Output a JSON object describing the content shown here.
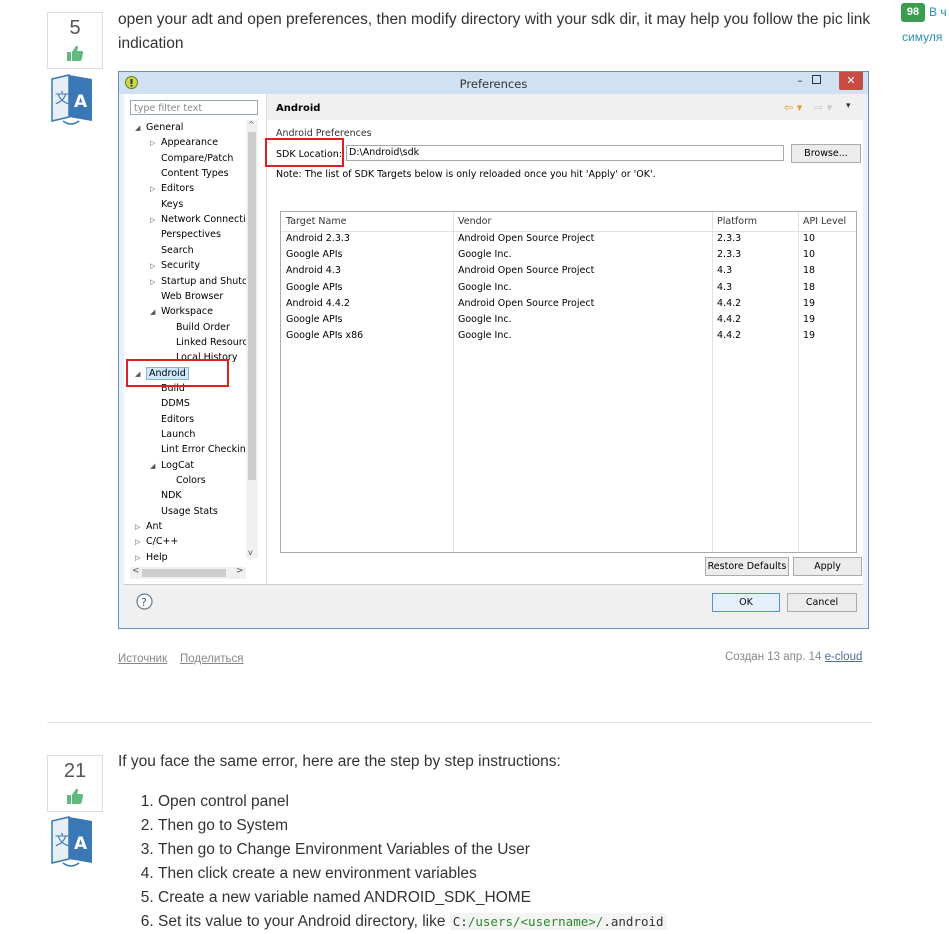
{
  "answers": [
    {
      "votes": "5",
      "text": "open your adt and open preferences, then modify directory with your sdk dir, it may help you follow the pic link indication",
      "links": [
        "Источник",
        "Поделиться"
      ],
      "created_label": "Создан 13 апр. 14",
      "author": "e-cloud"
    },
    {
      "votes": "21",
      "text": "If you face the same error, here are the step by step instructions:",
      "steps": [
        "Open control panel",
        "Then go to System",
        "Then go to Change Environment Variables of the User",
        "Then click create a new environment variables",
        "Create a new variable named ANDROID_SDK_HOME",
        "Set its value to your Android directory, like "
      ],
      "step6_code_parts": [
        "C:",
        "/users/",
        "<username>",
        "/",
        ".android"
      ]
    }
  ],
  "sidebar": {
    "badge": "98",
    "line1": "В ч",
    "line2": "симуля"
  },
  "dialog": {
    "title": "Preferences",
    "filter_placeholder": "type filter text",
    "page_title": "Android",
    "section_label": "Android Preferences",
    "sdk_label": "SDK Location:",
    "sdk_value": "D:\\Android\\sdk",
    "browse_label": "Browse...",
    "note": "Note: The list of SDK Targets below is only reloaded once you hit 'Apply' or 'OK'.",
    "columns": [
      "Target Name",
      "Vendor",
      "Platform",
      "API Level"
    ],
    "rows": [
      [
        "Android 2.3.3",
        "Android Open Source Project",
        "2.3.3",
        "10"
      ],
      [
        "Google APIs",
        "Google Inc.",
        "2.3.3",
        "10"
      ],
      [
        "Android 4.3",
        "Android Open Source Project",
        "4.3",
        "18"
      ],
      [
        "Google APIs",
        "Google Inc.",
        "4.3",
        "18"
      ],
      [
        "Android 4.4.2",
        "Android Open Source Project",
        "4.4.2",
        "19"
      ],
      [
        "Google APIs",
        "Google Inc.",
        "4.4.2",
        "19"
      ],
      [
        "Google APIs x86",
        "Google Inc.",
        "4.4.2",
        "19"
      ]
    ],
    "restore_label": "Restore Defaults",
    "apply_label": "Apply",
    "ok_label": "OK",
    "cancel_label": "Cancel",
    "tree": [
      "General",
      "Appearance",
      "Compare/Patch",
      "Content Types",
      "Editors",
      "Keys",
      "Network Connectio",
      "Perspectives",
      "Search",
      "Security",
      "Startup and Shutd",
      "Web Browser",
      "Workspace",
      "Build Order",
      "Linked Resourc",
      "Local History",
      "Android",
      "Build",
      "DDMS",
      "Editors",
      "Launch",
      "Lint Error Checking",
      "LogCat",
      "Colors",
      "NDK",
      "Usage Stats",
      "Ant",
      "C/C++",
      "Help"
    ]
  }
}
